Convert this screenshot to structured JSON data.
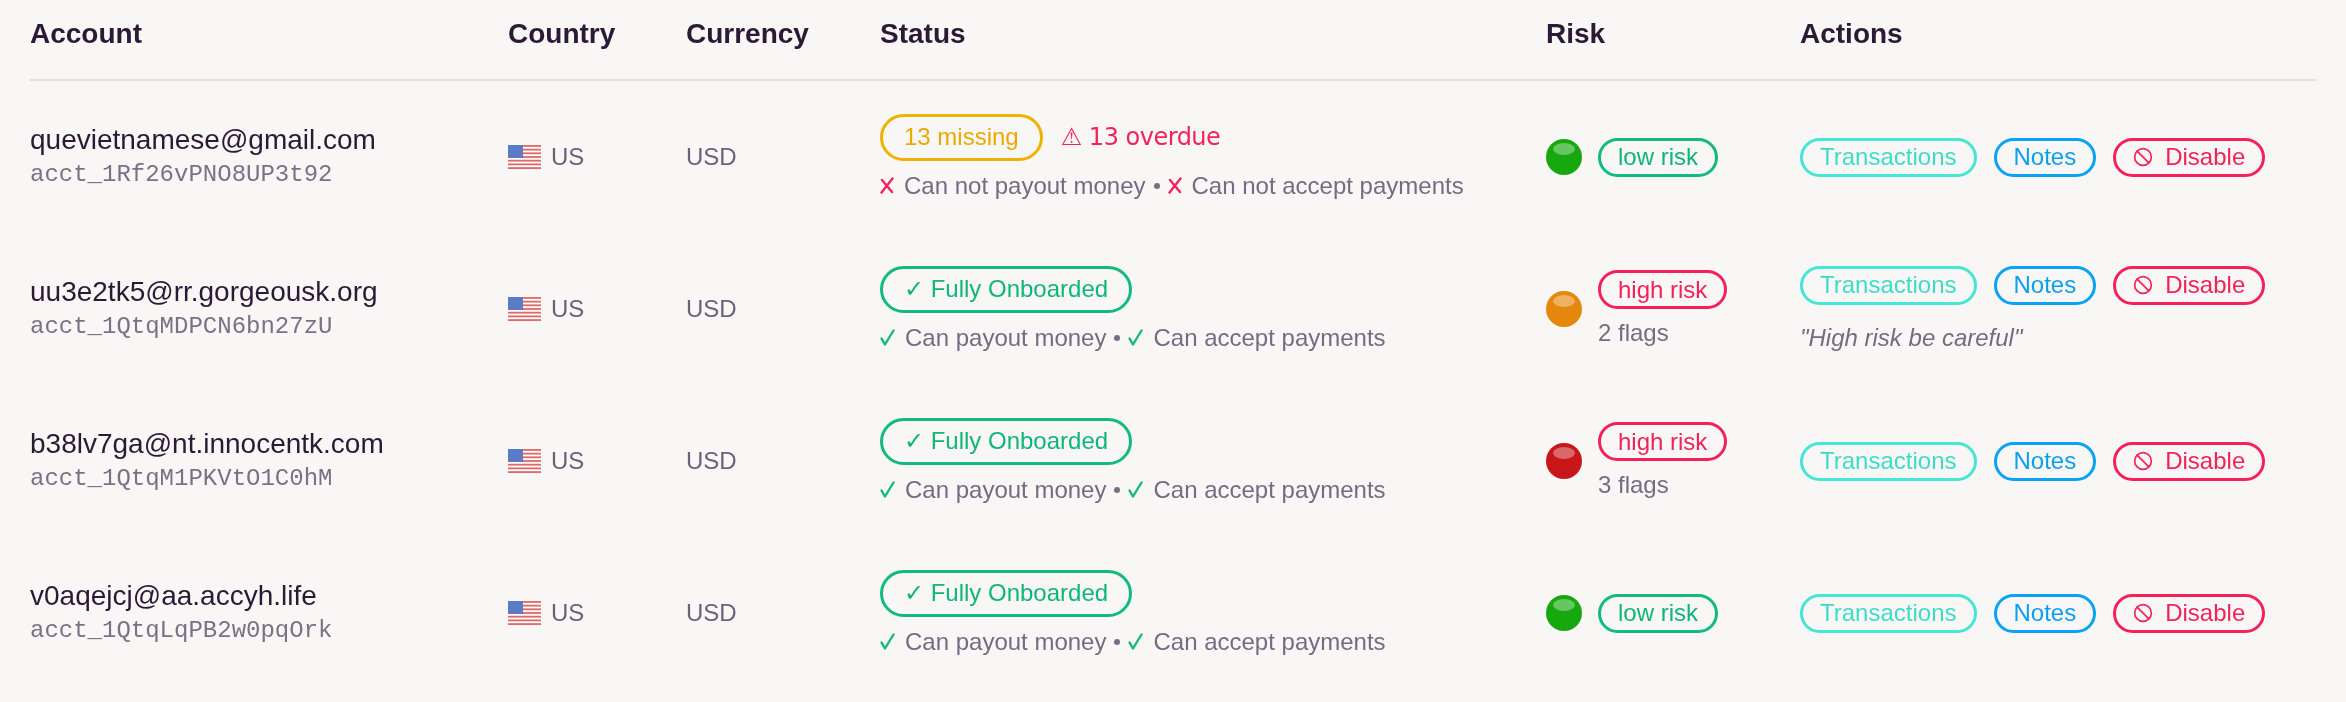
{
  "columns": [
    "Account",
    "Country",
    "Currency",
    "Status",
    "Risk",
    "Actions"
  ],
  "rows": [
    {
      "email": "quevietnamese@gmail.com",
      "account_id": "acct_1Rf26vPNO8UP3t92",
      "country": "US",
      "currency": "USD",
      "status": {
        "kind": "pending",
        "badge": "13 missing",
        "warning": "⚠ 13 overdue",
        "capabilities": [
          {
            "label": "Can not payout money",
            "ok": false
          },
          {
            "label": "Can not accept payments",
            "ok": false
          }
        ]
      },
      "risk": {
        "kind": "low",
        "label": "low risk",
        "color": "#17a80f"
      },
      "actions": [
        {
          "kind": "history",
          "label": "Transactions"
        },
        {
          "kind": "notes",
          "label": "Notes"
        },
        {
          "kind": "danger",
          "label": "Disable"
        }
      ]
    },
    {
      "email": "uu3e2tk5@rr.gorgeousk.org",
      "account_id": "acct_1QtqMDPCN6bn27zU",
      "country": "US",
      "currency": "USD",
      "status": {
        "kind": "onboarded",
        "badge": "✓ Fully Onboarded",
        "capabilities": [
          {
            "label": "Can payout money",
            "ok": true
          },
          {
            "label": "Can accept payments",
            "ok": true
          }
        ]
      },
      "risk": {
        "kind": "high",
        "label": "high risk",
        "color": "#e5870c",
        "flags": "2 flags"
      },
      "actions": [
        {
          "kind": "history",
          "label": "Transactions"
        },
        {
          "kind": "notes",
          "label": "Notes"
        },
        {
          "kind": "danger",
          "label": "Disable"
        }
      ],
      "note": "\"High risk be careful\""
    },
    {
      "email": "b38lv7ga@nt.innocentk.com",
      "account_id": "acct_1QtqM1PKVtO1C0hM",
      "country": "US",
      "currency": "USD",
      "status": {
        "kind": "onboarded",
        "badge": "✓ Fully Onboarded",
        "capabilities": [
          {
            "label": "Can payout money",
            "ok": true
          },
          {
            "label": "Can accept payments",
            "ok": true
          }
        ]
      },
      "risk": {
        "kind": "high",
        "label": "high risk",
        "color": "#c8161a",
        "flags": "3 flags"
      },
      "actions": [
        {
          "kind": "history",
          "label": "Transactions"
        },
        {
          "kind": "notes",
          "label": "Notes"
        },
        {
          "kind": "danger",
          "label": "Disable"
        }
      ]
    },
    {
      "email": "v0aqejcj@aa.accyh.life",
      "account_id": "acct_1QtqLqPB2w0pqOrk",
      "country": "US",
      "currency": "USD",
      "status": {
        "kind": "onboarded",
        "badge": "✓ Fully Onboarded",
        "capabilities": [
          {
            "label": "Can payout money",
            "ok": true
          },
          {
            "label": "Can accept payments",
            "ok": true
          }
        ]
      },
      "risk": {
        "kind": "low",
        "label": "low risk",
        "color": "#17a80f"
      },
      "actions": [
        {
          "kind": "history",
          "label": "Transactions"
        },
        {
          "kind": "notes",
          "label": "Notes"
        },
        {
          "kind": "danger",
          "label": "Disable"
        }
      ]
    }
  ]
}
